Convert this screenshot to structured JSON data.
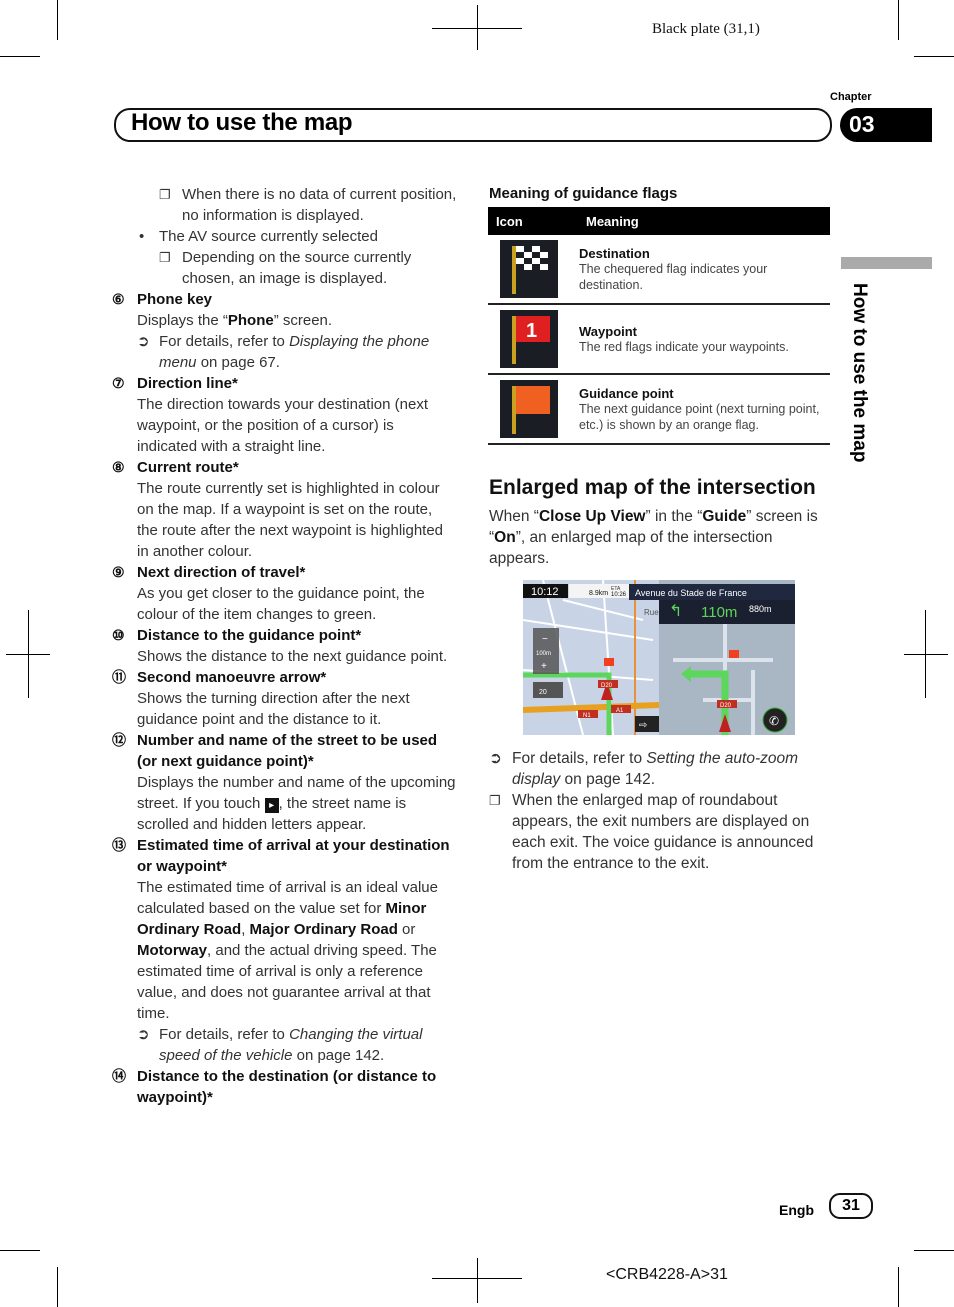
{
  "plate": "Black plate (31,1)",
  "header": {
    "title": "How to use the map",
    "chapter_label": "Chapter",
    "chapter_number": "03"
  },
  "side_tab": "How to use the map",
  "left_items": [
    {
      "type": "sq",
      "segs": [
        "When there is no data of current position, no information is displayed."
      ]
    },
    {
      "type": "bl",
      "segs": [
        "The AV source currently selected"
      ]
    },
    {
      "type": "sq",
      "segs": [
        "Depending on the source currently chosen, an image is displayed."
      ]
    },
    {
      "type": "hd",
      "num": "⑥",
      "segs": [
        "Phone key"
      ]
    },
    {
      "type": "p",
      "segs": [
        "Displays the “",
        {
          "b": "Phone"
        },
        "” screen."
      ]
    },
    {
      "type": "ref",
      "segs": [
        "For details, refer to ",
        {
          "i": "Displaying the phone menu"
        },
        " on page 67."
      ]
    },
    {
      "type": "hd",
      "num": "⑦",
      "segs": [
        "Direction line*"
      ]
    },
    {
      "type": "p",
      "segs": [
        "The direction towards your destination (next waypoint, or the position of a cursor) is indicated with a straight line."
      ]
    },
    {
      "type": "hd",
      "num": "⑧",
      "segs": [
        "Current route*"
      ]
    },
    {
      "type": "p",
      "segs": [
        "The route currently set is highlighted in colour on the map. If a waypoint is set on the route, the route after the next waypoint is highlighted in another colour."
      ]
    },
    {
      "type": "hd",
      "num": "⑨",
      "segs": [
        "Next direction of travel*"
      ]
    },
    {
      "type": "p",
      "segs": [
        "As you get closer to the guidance point, the colour of the item changes to green."
      ]
    },
    {
      "type": "hd",
      "num": "⑩",
      "segs": [
        "Distance to the guidance point*"
      ]
    },
    {
      "type": "p",
      "segs": [
        "Shows the distance to the next guidance point."
      ]
    },
    {
      "type": "hd",
      "num": "⑪",
      "segs": [
        "Second manoeuvre arrow*"
      ]
    },
    {
      "type": "p",
      "segs": [
        "Shows the turning direction after the next guidance point and the distance to it."
      ]
    },
    {
      "type": "hd",
      "num": "⑫",
      "segs": [
        "Number and name of the street to be used (or next guidance point)*"
      ]
    },
    {
      "type": "p",
      "segs": [
        "Displays the number and name of the upcoming street. If you touch ",
        {
          "icon": "play"
        },
        ", the street name is scrolled and hidden letters appear."
      ]
    },
    {
      "type": "hd",
      "num": "⑬",
      "segs": [
        "Estimated time of arrival at your destination or waypoint*"
      ]
    },
    {
      "type": "p",
      "segs": [
        "The estimated time of arrival is an ideal value calculated based on the value set for ",
        {
          "b": "Minor Ordinary Road"
        },
        ", ",
        {
          "b": "Major Ordinary Road"
        },
        " or ",
        {
          "b": "Motorway"
        },
        ", and the actual driving speed. The estimated time of arrival is only a reference value, and does not guarantee arrival at that time."
      ]
    },
    {
      "type": "ref",
      "segs": [
        "For details, refer to ",
        {
          "i": "Changing the virtual speed of the vehicle"
        },
        " on page 142."
      ]
    },
    {
      "type": "hd",
      "num": "⑭",
      "segs": [
        "Distance to the destination (or distance to waypoint)*"
      ]
    }
  ],
  "flags": {
    "heading": "Meaning of guidance flags",
    "col_icon": "Icon",
    "col_meaning": "Meaning",
    "rows": [
      {
        "icon": "chequered-flag-icon",
        "name": "Destination",
        "desc": "The chequered flag indicates your destination."
      },
      {
        "icon": "red-flag-icon",
        "name": "Waypoint",
        "desc": "The red flags indicate your waypoints."
      },
      {
        "icon": "orange-flag-icon",
        "name": "Guidance point",
        "desc": "The next guidance point (next turning point, etc.) is shown by an orange flag."
      }
    ]
  },
  "enlarged": {
    "heading": "Enlarged map of the intersection",
    "para": [
      "When “",
      {
        "b": "Close Up View"
      },
      "” in the “",
      {
        "b": "Guide"
      },
      "” screen is “",
      {
        "b": "On"
      },
      "”, an enlarged map of the intersection appears."
    ],
    "map": {
      "time": "10:12",
      "dist": "8.9km",
      "eta_label": "ETA",
      "eta": "10:26",
      "street": "Avenue du Stade de France",
      "next_dist": "110m",
      "second_dist": "880m",
      "scale": "100m",
      "road1": "D20",
      "road2": "N1",
      "road3": "A1",
      "street_partial": "Rue",
      "speed": "20"
    },
    "notes": [
      {
        "type": "ref",
        "segs": [
          "For details, refer to ",
          {
            "i": "Setting the auto-zoom display"
          },
          " on page 142."
        ]
      },
      {
        "type": "sq",
        "segs": [
          "When the enlarged map of roundabout appears, the exit numbers are displayed on each exit. The voice guidance is announced from the entrance to the exit."
        ]
      }
    ]
  },
  "footer": {
    "lang": "Engb",
    "page": "31",
    "code": "<CRB4228-A>31"
  },
  "colors": {
    "map_green": "#5cd65c",
    "flag_red": "#e02020",
    "flag_orange": "#f06020"
  }
}
